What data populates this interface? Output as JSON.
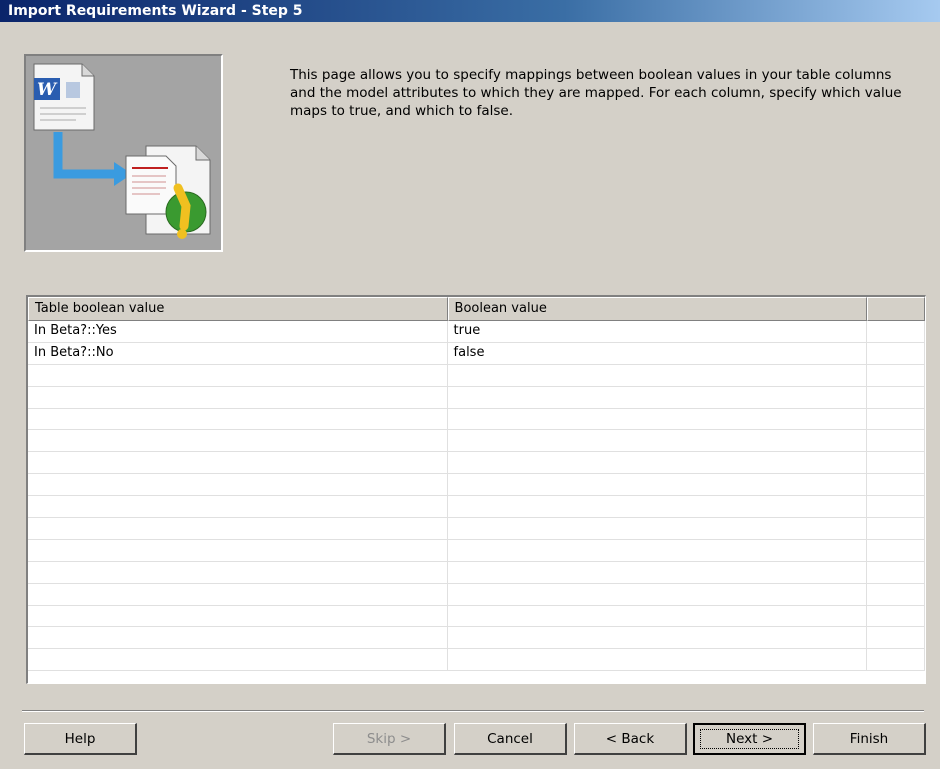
{
  "window": {
    "title": "Import Requirements Wizard - Step 5"
  },
  "description": "This page allows you to specify mappings between boolean values in your table columns and the model attributes to which they are mapped. For each column, specify which value maps to true, and which to false.",
  "table": {
    "columns": [
      "Table boolean value",
      "Boolean value",
      ""
    ],
    "rows": [
      [
        "In Beta?::Yes",
        "true"
      ],
      [
        "In Beta?::No",
        "false"
      ]
    ],
    "empty_rows": 14
  },
  "buttons": {
    "help": "Help",
    "skip": "Skip >",
    "cancel": "Cancel",
    "back": "< Back",
    "next": "Next >",
    "finish": "Finish"
  },
  "icons": {
    "word_document": "word-document-icon",
    "arrow": "arrow-icon",
    "requirements_document": "requirements-document-icon"
  },
  "colors": {
    "title_bar": "#0a246a",
    "dialog_background": "#d4d0c8",
    "image_panel": "#a4a4a4"
  }
}
